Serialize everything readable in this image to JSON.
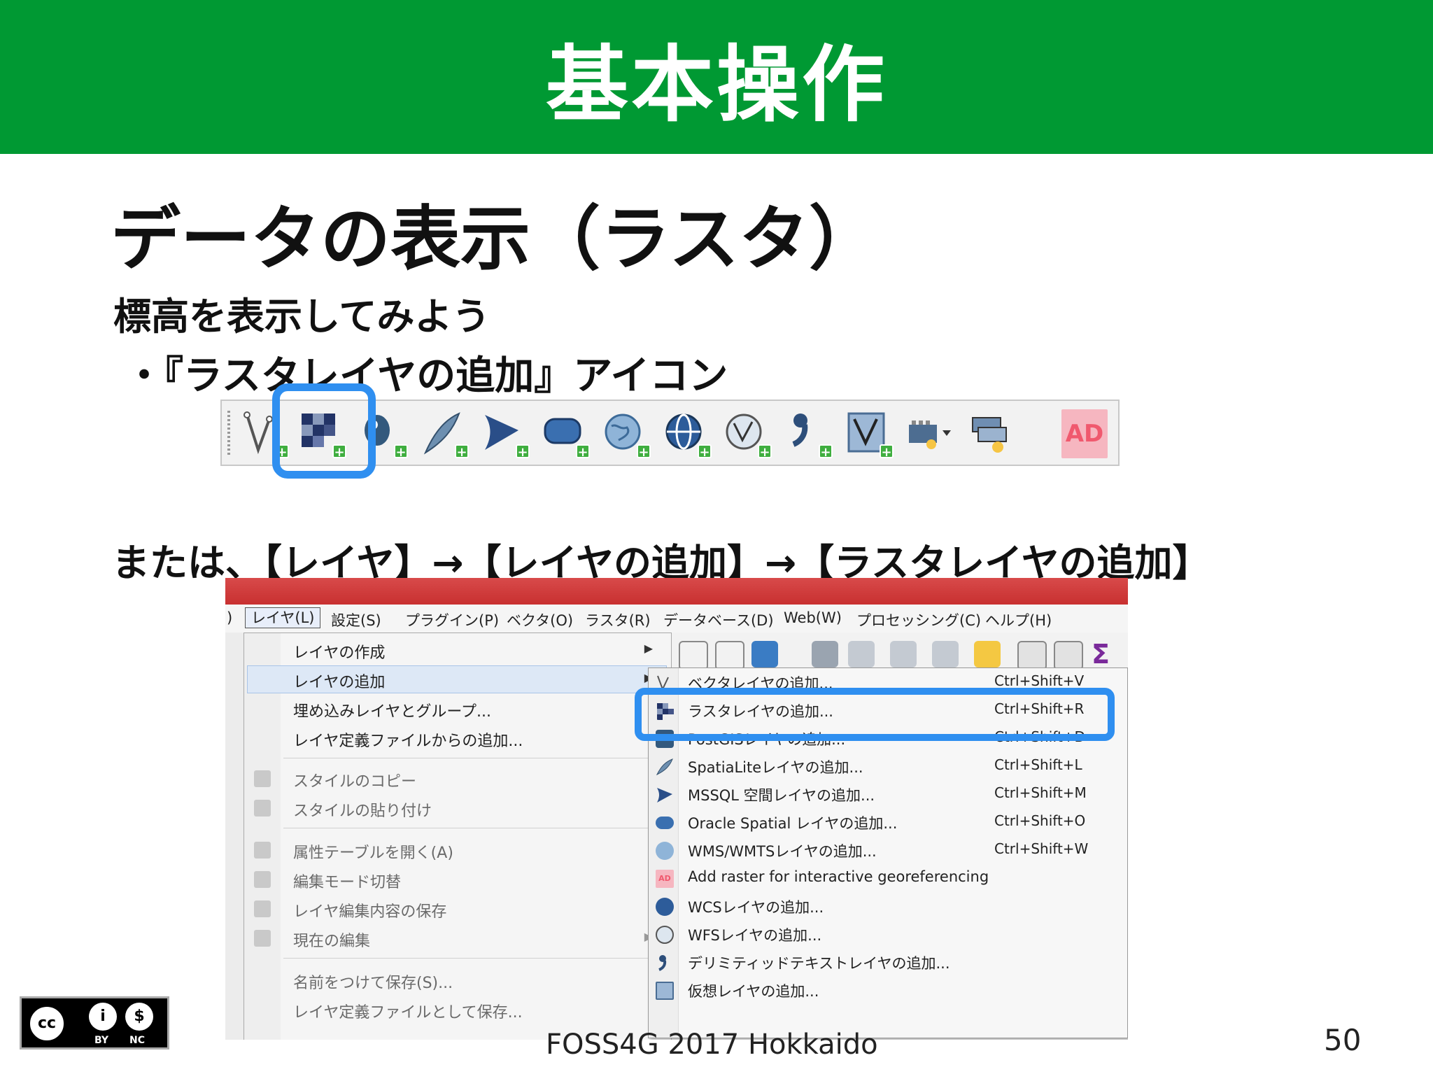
{
  "header": {
    "title": "基本操作"
  },
  "slide": {
    "subtitle": "データの表示（ラスタ）",
    "lead": "標高を表示してみよう",
    "bullet": "・『ラスタレイヤの追加』アイコン",
    "alt": "または、【レイヤ】→【レイヤの追加】→【ラスタレイヤの追加】"
  },
  "toolbar": {
    "icons": [
      "vector-layer-icon",
      "raster-layer-icon",
      "postgis-layer-icon",
      "spatialite-layer-icon",
      "mssql-layer-icon",
      "oracle-layer-icon",
      "wms-layer-icon",
      "wcs-layer-icon",
      "wfs-layer-icon",
      "delimited-text-icon",
      "virtual-layer-icon",
      "gps-tool-icon",
      "gps-import-icon",
      "georeferencer-icon"
    ],
    "ad_label": "AD"
  },
  "menubar": {
    "items": [
      ")",
      "レイヤ(L)",
      "設定(S)",
      "プラグイン(P)",
      "ベクタ(O)",
      "ラスタ(R)",
      "データベース(D)",
      "Web(W)",
      "プロセッシング(C)",
      "ヘルプ(H)"
    ]
  },
  "layer_menu": {
    "items": [
      {
        "label": "レイヤの作成",
        "sub": true
      },
      {
        "label": "レイヤの追加",
        "sub": true
      },
      {
        "label": "埋め込みレイヤとグループ..."
      },
      {
        "label": "レイヤ定義ファイルからの追加..."
      },
      {
        "label": "スタイルのコピー"
      },
      {
        "label": "スタイルの貼り付け"
      },
      {
        "label": "属性テーブルを開く(A)"
      },
      {
        "label": "編集モード切替"
      },
      {
        "label": "レイヤ編集内容の保存"
      },
      {
        "label": "現在の編集",
        "sub": true
      },
      {
        "label": "名前をつけて保存(S)..."
      },
      {
        "label": "レイヤ定義ファイルとして保存..."
      }
    ]
  },
  "add_layer_menu": {
    "items": [
      {
        "label": "ベクタレイヤの追加...",
        "shortcut": "Ctrl+Shift+V"
      },
      {
        "label": "ラスタレイヤの追加...",
        "shortcut": "Ctrl+Shift+R"
      },
      {
        "label": "PostGISレイヤの追加...",
        "shortcut": "Ctrl+Shift+D"
      },
      {
        "label": "SpatiaLiteレイヤの追加...",
        "shortcut": "Ctrl+Shift+L"
      },
      {
        "label": "MSSQL 空間レイヤの追加...",
        "shortcut": "Ctrl+Shift+M"
      },
      {
        "label": "Oracle Spatial レイヤの追加...",
        "shortcut": "Ctrl+Shift+O"
      },
      {
        "label": "WMS/WMTSレイヤの追加...",
        "shortcut": "Ctrl+Shift+W"
      },
      {
        "label": "Add raster for interactive georeferencing",
        "shortcut": ""
      },
      {
        "label": "WCSレイヤの追加...",
        "shortcut": ""
      },
      {
        "label": "WFSレイヤの追加...",
        "shortcut": ""
      },
      {
        "label": "デリミティッドテキストレイヤの追加...",
        "shortcut": ""
      },
      {
        "label": "仮想レイヤの追加...",
        "shortcut": ""
      }
    ]
  },
  "footer": {
    "cc_by": "BY",
    "cc_nc": "NC",
    "event": "FOSS4G 2017 Hokkaido",
    "page": "50"
  },
  "colors": {
    "header_green": "#009933",
    "highlight_blue": "#2f8ff0"
  }
}
